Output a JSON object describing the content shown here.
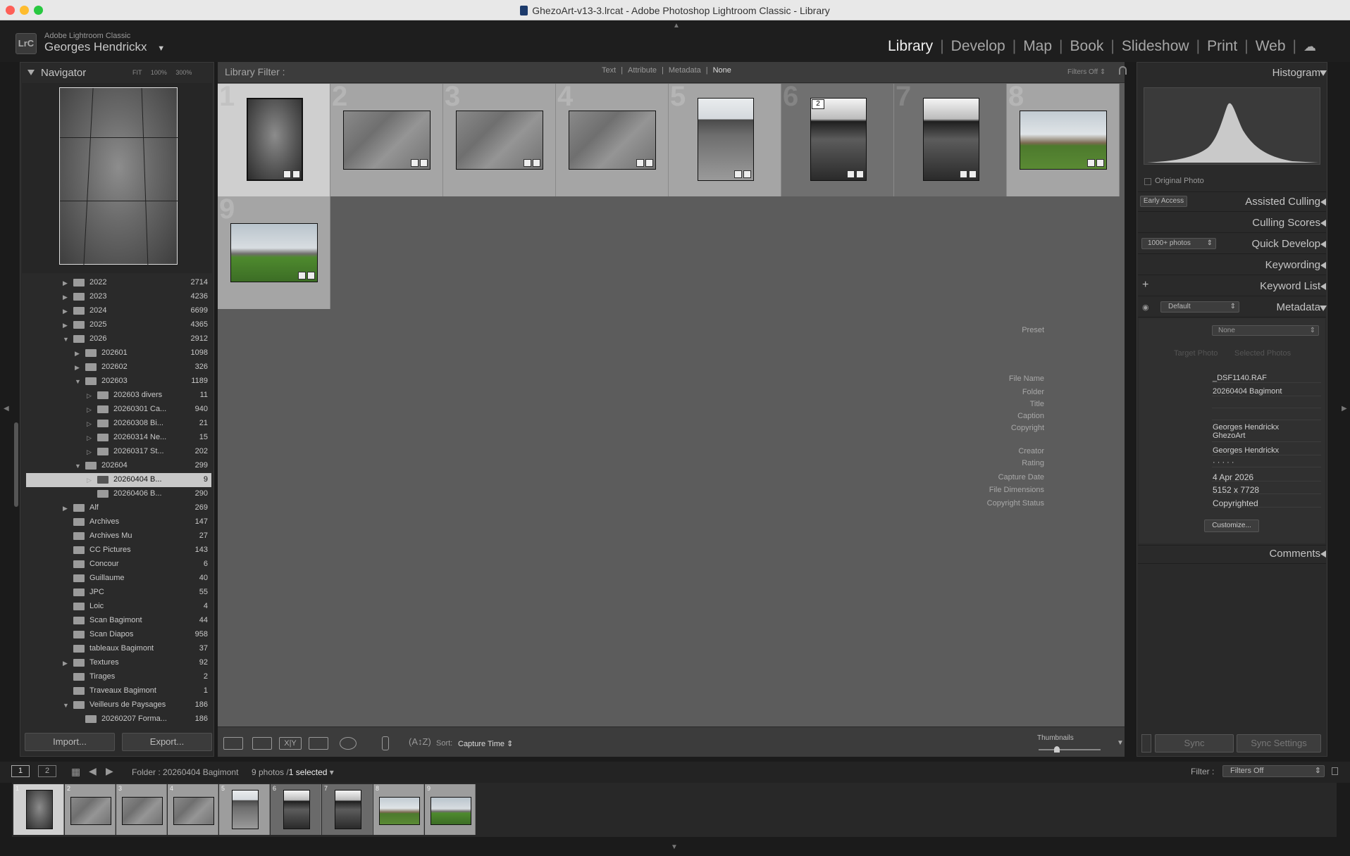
{
  "window": {
    "title": "GhezoArt-v13-3.lrcat - Adobe Photoshop Lightroom Classic - Library",
    "traffic_lights": [
      "#fe5f57",
      "#febc2e",
      "#28c840"
    ]
  },
  "identity": {
    "logo": "LrC",
    "product": "Adobe Lightroom Classic",
    "user": "Georges Hendrickx"
  },
  "modules": [
    "Library",
    "Develop",
    "Map",
    "Book",
    "Slideshow",
    "Print",
    "Web"
  ],
  "navigator": {
    "title": "Navigator",
    "zoom": [
      "FIT",
      "100%",
      "300%"
    ]
  },
  "folders": [
    {
      "name": "2022",
      "count": "2714",
      "depth": 0,
      "tri": "▶"
    },
    {
      "name": "2023",
      "count": "4236",
      "depth": 0,
      "tri": "▶"
    },
    {
      "name": "2024",
      "count": "6699",
      "depth": 0,
      "tri": "▶"
    },
    {
      "name": "2025",
      "count": "4365",
      "depth": 0,
      "tri": "▶"
    },
    {
      "name": "2026",
      "count": "2912",
      "depth": 0,
      "tri": "▼"
    },
    {
      "name": "202601",
      "count": "1098",
      "depth": 1,
      "tri": "▶"
    },
    {
      "name": "202602",
      "count": "326",
      "depth": 1,
      "tri": "▶"
    },
    {
      "name": "202603",
      "count": "1189",
      "depth": 1,
      "tri": "▼"
    },
    {
      "name": "202603 divers",
      "count": "11",
      "depth": 2,
      "tri": "▷"
    },
    {
      "name": "20260301 Ca...",
      "count": "940",
      "depth": 2,
      "tri": "▷"
    },
    {
      "name": "20260308 Bi...",
      "count": "21",
      "depth": 2,
      "tri": "▷"
    },
    {
      "name": "20260314 Ne...",
      "count": "15",
      "depth": 2,
      "tri": "▷"
    },
    {
      "name": "20260317 St...",
      "count": "202",
      "depth": 2,
      "tri": "▷"
    },
    {
      "name": "202604",
      "count": "299",
      "depth": 1,
      "tri": "▼"
    },
    {
      "name": "20260404 B...",
      "count": "9",
      "depth": 2,
      "tri": "▷",
      "selected": true
    },
    {
      "name": "20260406 B...",
      "count": "290",
      "depth": 2,
      "tri": ""
    },
    {
      "name": "Alf",
      "count": "269",
      "depth": 0,
      "tri": "▶"
    },
    {
      "name": "Archives",
      "count": "147",
      "depth": 0,
      "tri": ""
    },
    {
      "name": "Archives Mu",
      "count": "27",
      "depth": 0,
      "tri": ""
    },
    {
      "name": "CC Pictures",
      "count": "143",
      "depth": 0,
      "tri": ""
    },
    {
      "name": "Concour",
      "count": "6",
      "depth": 0,
      "tri": ""
    },
    {
      "name": "Guillaume",
      "count": "40",
      "depth": 0,
      "tri": ""
    },
    {
      "name": "JPC",
      "count": "55",
      "depth": 0,
      "tri": ""
    },
    {
      "name": "Loic",
      "count": "4",
      "depth": 0,
      "tri": ""
    },
    {
      "name": "Scan Bagimont",
      "count": "44",
      "depth": 0,
      "tri": ""
    },
    {
      "name": "Scan Diapos",
      "count": "958",
      "depth": 0,
      "tri": ""
    },
    {
      "name": "tableaux Bagimont",
      "count": "37",
      "depth": 0,
      "tri": ""
    },
    {
      "name": "Textures",
      "count": "92",
      "depth": 0,
      "tri": "▶"
    },
    {
      "name": "Tirages",
      "count": "2",
      "depth": 0,
      "tri": ""
    },
    {
      "name": "Traveaux Bagimont",
      "count": "1",
      "depth": 0,
      "tri": ""
    },
    {
      "name": "Veilleurs de Paysages",
      "count": "186",
      "depth": 0,
      "tri": "▼"
    },
    {
      "name": "20260207 Forma...",
      "count": "186",
      "depth": 1,
      "tri": ""
    }
  ],
  "left_buttons": {
    "import": "Import...",
    "export": "Export..."
  },
  "filter": {
    "label": "Library Filter :",
    "options": [
      "Text",
      "Attribute",
      "Metadata",
      "None"
    ],
    "active": "None",
    "status": "Filters Off"
  },
  "grid": [
    {
      "num": "1",
      "type": "stone-dark",
      "orient": "portrait",
      "selected": true
    },
    {
      "num": "2",
      "type": "stone",
      "orient": "landscape"
    },
    {
      "num": "3",
      "type": "stone",
      "orient": "landscape"
    },
    {
      "num": "4",
      "type": "stone",
      "orient": "landscape"
    },
    {
      "num": "5",
      "type": "table-img",
      "orient": "portrait"
    },
    {
      "num": "6",
      "type": "table-dark",
      "orient": "portrait",
      "dim": true,
      "stack": "2"
    },
    {
      "num": "7",
      "type": "table-dark",
      "orient": "portrait",
      "dim": true
    },
    {
      "num": "8",
      "type": "landscape",
      "orient": "landscape"
    },
    {
      "num": "9",
      "type": "landscape2",
      "orient": "landscape"
    }
  ],
  "toolbar": {
    "sort_label": "Sort:",
    "sort_value": "Capture Time",
    "thumbnails_label": "Thumbnails",
    "thumbnail_size": 0.3
  },
  "right": {
    "histogram": "Histogram",
    "original_photo": "Original Photo",
    "early_access": "Early Access",
    "assisted_culling": "Assisted Culling",
    "culling_scores": "Culling Scores",
    "quick_develop_preset": "1000+ photos",
    "quick_develop": "Quick Develop",
    "keywording": "Keywording",
    "keyword_list": "Keyword List",
    "metadata_preset_select": "Default",
    "metadata": "Metadata",
    "preset_label": "Preset",
    "preset_value": "None",
    "target_photo": "Target Photo",
    "selected_photos": "Selected Photos",
    "fields": [
      {
        "label": "File Name",
        "value": "_DSF1140.RAF"
      },
      {
        "label": "Folder",
        "value": "20260404 Bagimont"
      },
      {
        "label": "Title",
        "value": ""
      },
      {
        "label": "Caption",
        "value": ""
      },
      {
        "label": "Copyright",
        "value": "Georges Hendrickx\nGhezoArt"
      },
      {
        "label": "Creator",
        "value": "Georges Hendrickx"
      },
      {
        "label": "Rating",
        "value": "·  ·  ·  ·  ·"
      },
      {
        "label": "Capture Date",
        "value": "4 Apr 2026"
      },
      {
        "label": "File Dimensions",
        "value": "5152 x 7728"
      },
      {
        "label": "Copyright Status",
        "value": "Copyrighted"
      }
    ],
    "customize": "Customize...",
    "comments": "Comments",
    "sync": "Sync",
    "sync_settings": "Sync Settings"
  },
  "filmstrip_bar": {
    "screen1": "1",
    "screen2": "2",
    "folder": "Folder : 20260404 Bagimont",
    "count": "9 photos /",
    "selected": "1 selected",
    "filter_label": "Filter :",
    "filter_value": "Filters Off"
  }
}
